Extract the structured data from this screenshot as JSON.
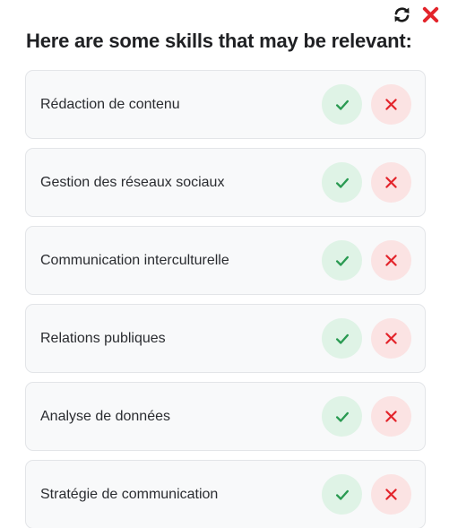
{
  "colors": {
    "accept": "#2a9a52",
    "reject": "#e3242b",
    "accept_bg": "#dff3e6",
    "reject_bg": "#fbe3e3"
  },
  "header": {
    "title": "Here are some skills that may be relevant:",
    "icons": [
      "refresh-icon",
      "close-icon"
    ]
  },
  "skills": [
    {
      "label": "Rédaction de contenu"
    },
    {
      "label": "Gestion des réseaux sociaux"
    },
    {
      "label": "Communication interculturelle"
    },
    {
      "label": "Relations publiques"
    },
    {
      "label": "Analyse de données"
    },
    {
      "label": "Stratégie de communication"
    }
  ]
}
